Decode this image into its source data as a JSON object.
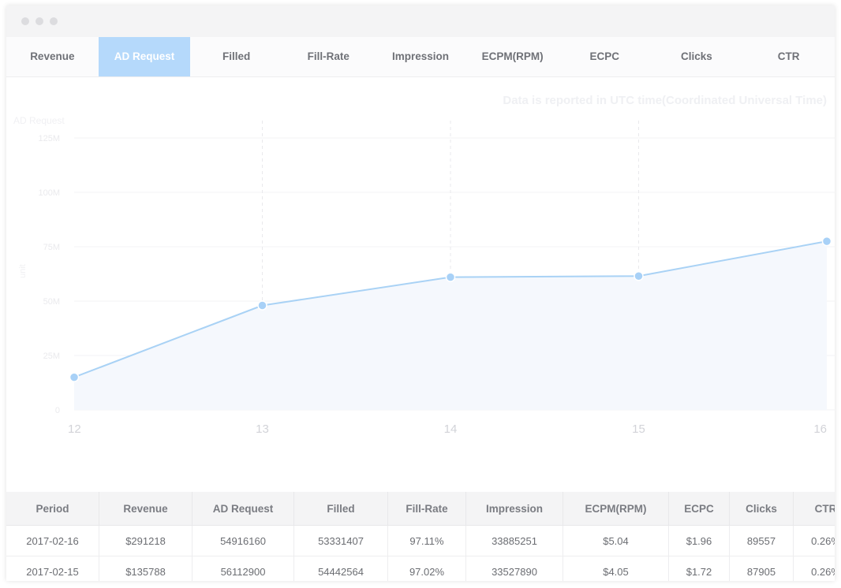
{
  "tabs": [
    {
      "label": "Revenue",
      "active": false
    },
    {
      "label": "AD Request",
      "active": true
    },
    {
      "label": "Filled",
      "active": false
    },
    {
      "label": "Fill-Rate",
      "active": false
    },
    {
      "label": "Impression",
      "active": false
    },
    {
      "label": "ECPM(RPM)",
      "active": false
    },
    {
      "label": "ECPC",
      "active": false
    },
    {
      "label": "Clicks",
      "active": false
    },
    {
      "label": "CTR",
      "active": false
    }
  ],
  "colors": {
    "accent": "#b5d9fb",
    "line": "#a9d2f5",
    "point": "#a8d1f7",
    "fill": "#f5f8fd",
    "faint_text": "#efeff2"
  },
  "chart_data": {
    "type": "line",
    "note": "Data is reported in UTC time(Coordinated Universal Time)",
    "series_label": "AD Request",
    "ylabel": "unit",
    "x": [
      12,
      13,
      14,
      15,
      16
    ],
    "y_ticks": [
      "0",
      "25M",
      "50M",
      "75M",
      "100M",
      "125M"
    ],
    "ylim": [
      0,
      125000000
    ],
    "values": [
      15000000,
      48000000,
      61000000,
      61500000,
      77500000
    ],
    "grid": true
  },
  "table": {
    "columns": [
      "Period",
      "Revenue",
      "AD Request",
      "Filled",
      "Fill-Rate",
      "Impression",
      "ECPM(RPM)",
      "ECPC",
      "Clicks",
      "CTR"
    ],
    "rows": [
      [
        "2017-02-16",
        "$291218",
        "54916160",
        "53331407",
        "97.11%",
        "33885251",
        "$5.04",
        "$1.96",
        "89557",
        "0.26%"
      ],
      [
        "2017-02-15",
        "$135788",
        "56112900",
        "54442564",
        "97.02%",
        "33527890",
        "$4.05",
        "$1.72",
        "87905",
        "0.26%"
      ]
    ]
  }
}
